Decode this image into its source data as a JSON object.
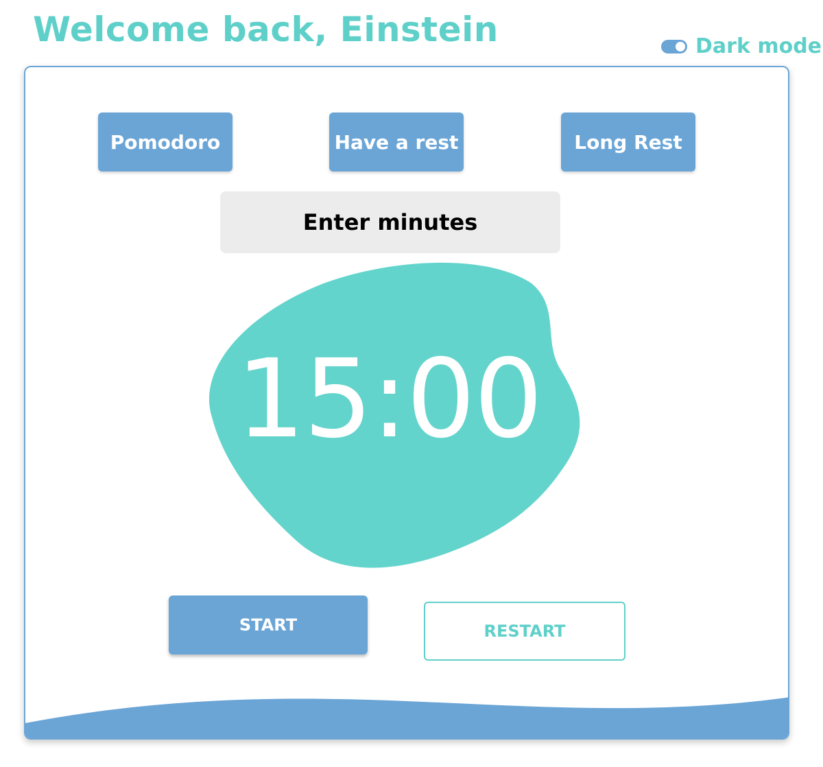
{
  "header": {
    "welcome_text": "Welcome back, Einstein",
    "dark_mode_label": "Dark mode",
    "dark_mode_on": true
  },
  "modes": [
    {
      "label": "Pomodoro"
    },
    {
      "label": "Have a rest"
    },
    {
      "label": "Long Rest"
    }
  ],
  "minutes_input": {
    "placeholder": "Enter minutes",
    "value": ""
  },
  "timer": {
    "display": "15:00"
  },
  "controls": {
    "start_label": "START",
    "restart_label": "RESTART"
  },
  "colors": {
    "accent_teal": "#5fd0c9",
    "accent_blue": "#6aa5d6",
    "input_bg": "#ececec"
  },
  "icons": {
    "dark_mode_toggle": "toggle-switch-icon"
  }
}
